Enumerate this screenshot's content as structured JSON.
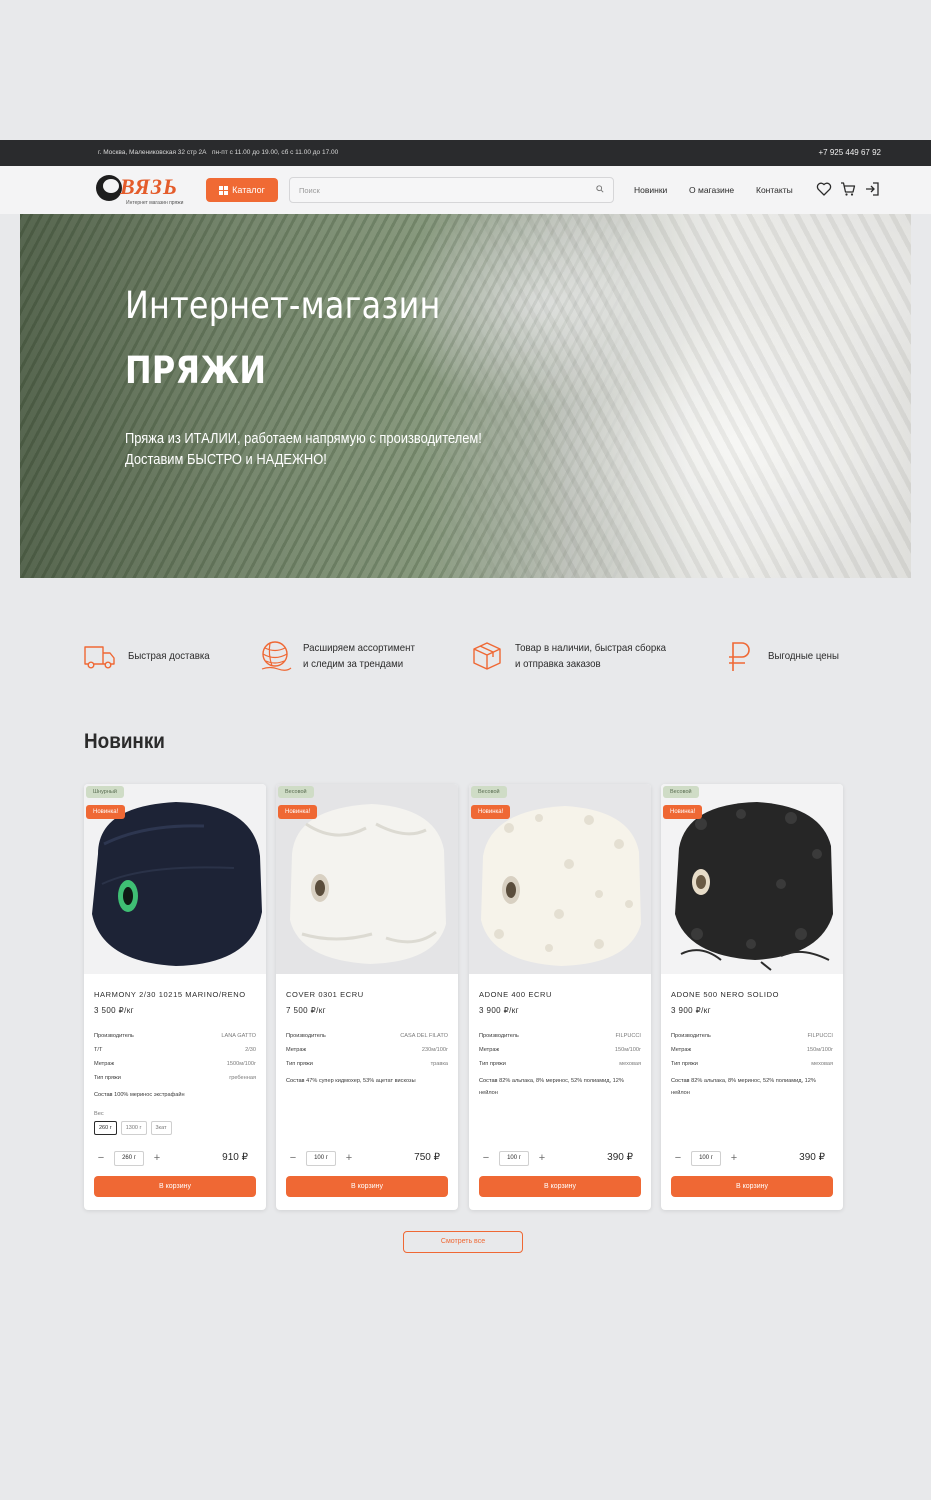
{
  "topbar": {
    "address": "г. Москва, Малениковская 32 стр 2А",
    "hours": "пн-пт с 11.00 до 19.00, сб с 11.00 до 17.00",
    "phone": "+7 925 449 67 92"
  },
  "header": {
    "logo_text": "ВЯЗЬ",
    "logo_tagline": "Интернет магазин пряжи",
    "catalog_label": "Каталог",
    "search_placeholder": "Поиск",
    "nav": [
      "Новинки",
      "О магазине",
      "Контакты"
    ],
    "icons": [
      "heart-icon",
      "cart-icon",
      "login-icon"
    ]
  },
  "hero": {
    "title_line1": "Интернет-магазин",
    "title_line2": "ПРЯЖИ",
    "subtitle_line1": "Пряжа из ИТАЛИИ, работаем напрямую с производителем!",
    "subtitle_line2": "Доставим БЫСТРО и НАДЕЖНО!"
  },
  "features": [
    {
      "icon": "truck-icon",
      "line1": "Быстрая доставка",
      "line2": ""
    },
    {
      "icon": "yarn-ball-icon",
      "line1": "Расширяем ассортимент",
      "line2": "и следим за трендами"
    },
    {
      "icon": "box-icon",
      "line1": "Товар в наличии, быстрая сборка",
      "line2": "и отправка заказов"
    },
    {
      "icon": "ruble-icon",
      "line1": "Выгодные цены",
      "line2": ""
    }
  ],
  "section_title": "Новинки",
  "products": [
    {
      "type_badge": "Шнурный",
      "new_badge": "Новинка!",
      "name": "HARMONY 2/30 10215 MARINO/RENO",
      "price_per_kg": "3 500 ₽/кг",
      "specs": [
        {
          "label": "Производитель",
          "value": "LANA GATTO"
        },
        {
          "label": "Т/Т",
          "value": "2/30"
        },
        {
          "label": "Метраж",
          "value": "1500м/100г"
        },
        {
          "label": "Тип пряжи",
          "value": "гребенная"
        }
      ],
      "composition_label": "Состав",
      "composition": "100% меринос экстрафайн",
      "weight_label": "Вес",
      "weights": [
        "260 г",
        "1300 г",
        "3кат"
      ],
      "qty": "260 г",
      "price": "910 ₽",
      "cart_label": "В корзину",
      "color": "#1d2336",
      "core": "#3fbf74"
    },
    {
      "type_badge": "Весовой",
      "new_badge": "Новинка!",
      "name": "COVER 0301 ECRU",
      "price_per_kg": "7 500 ₽/кг",
      "specs": [
        {
          "label": "Производитель",
          "value": "CASA DEL FILATO"
        },
        {
          "label": "Метраж",
          "value": "230м/100г"
        },
        {
          "label": "Тип пряжи",
          "value": "травка"
        }
      ],
      "composition_label": "Состав",
      "composition": "47% супер кидмохер, 53% ацетат вискозы",
      "weight_label": "",
      "weights": [],
      "qty": "100 г",
      "price": "750 ₽",
      "cart_label": "В корзину",
      "color": "#efeeea",
      "core": "#8a7b68"
    },
    {
      "type_badge": "Весовой",
      "new_badge": "Новинка!",
      "name": "ADONE 400 ECRU",
      "price_per_kg": "3 900 ₽/кг",
      "specs": [
        {
          "label": "Производитель",
          "value": "FILPUCCI"
        },
        {
          "label": "Метраж",
          "value": "150м/100г"
        },
        {
          "label": "Тип пряжи",
          "value": "меховая"
        }
      ],
      "composition_label": "Состав",
      "composition": "82% альпака, 8% меринос, 52% полиамид, 12% нейлон",
      "weight_label": "",
      "weights": [],
      "qty": "100 г",
      "price": "390 ₽",
      "cart_label": "В корзину",
      "color": "#f3f0e8",
      "core": "#8a7b68"
    },
    {
      "type_badge": "Весовой",
      "new_badge": "Новинка!",
      "name": "ADONE 500 NERO SOLIDO",
      "price_per_kg": "3 900 ₽/кг",
      "specs": [
        {
          "label": "Производитель",
          "value": "FILPUCCI"
        },
        {
          "label": "Метраж",
          "value": "150м/100г"
        },
        {
          "label": "Тип пряжи",
          "value": "меховая"
        }
      ],
      "composition_label": "Состав",
      "composition": "82% альпака, 8% меринос, 52% полиамид, 12% нейлон",
      "weight_label": "",
      "weights": [],
      "qty": "100 г",
      "price": "390 ₽",
      "cart_label": "В корзину",
      "color": "#2a2a2a",
      "core": "#c9b59c"
    }
  ],
  "view_all_label": "Смотреть все",
  "colors": {
    "accent": "#ef6834",
    "topbar": "#2a2b2d",
    "badge_type_bg": "#cfdcc6"
  }
}
